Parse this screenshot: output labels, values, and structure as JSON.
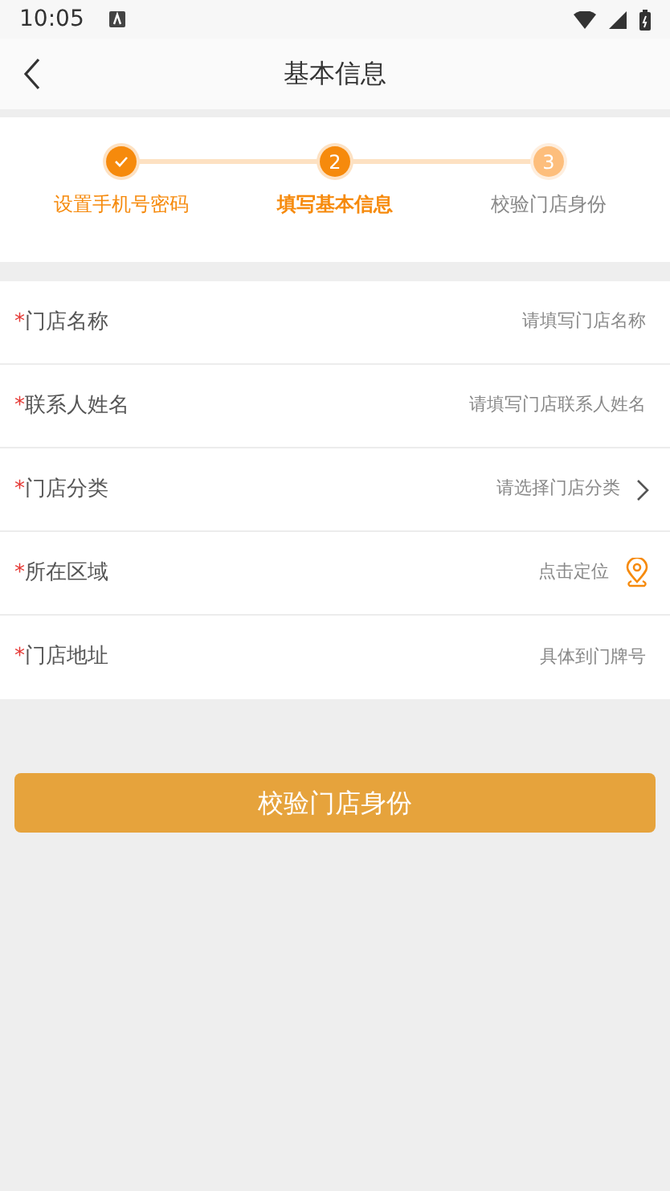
{
  "status_bar": {
    "time": "10:05"
  },
  "header": {
    "title": "基本信息"
  },
  "steps": [
    {
      "label": "设置手机号密码",
      "completed": true,
      "selected": false
    },
    {
      "marker": "2",
      "label": "填写基本信息",
      "completed": false,
      "selected": true
    },
    {
      "marker": "3",
      "label": "校验门店身份",
      "completed": false,
      "selected": false
    }
  ],
  "fields": [
    {
      "required_mark": "*",
      "label": "门店名称",
      "placeholder": "请填写门店名称",
      "kind": "text"
    },
    {
      "required_mark": "*",
      "label": "联系人姓名",
      "placeholder": "请填写门店联系人姓名",
      "kind": "text"
    },
    {
      "required_mark": "*",
      "label": "门店分类",
      "placeholder": "请选择门店分类",
      "kind": "select"
    },
    {
      "required_mark": "*",
      "label": "所在区域",
      "placeholder": "点击定位",
      "kind": "location"
    },
    {
      "required_mark": "*",
      "label": "门店地址",
      "placeholder": "具体到门牌号",
      "kind": "text"
    }
  ],
  "submit": {
    "label": "校验门店身份"
  }
}
